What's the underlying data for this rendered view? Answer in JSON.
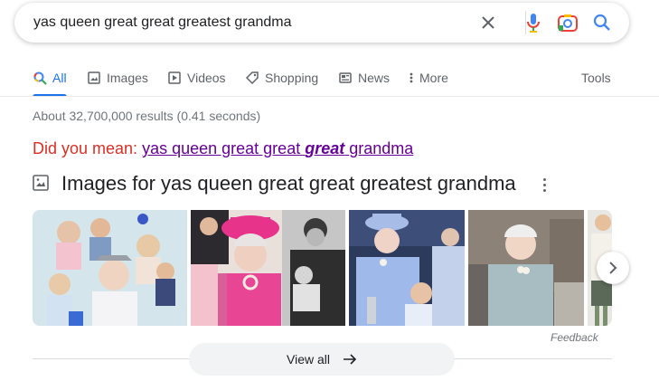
{
  "search": {
    "query": "yas queen great great greatest grandma"
  },
  "tabs": [
    {
      "label": "All",
      "icon": "search-icon"
    },
    {
      "label": "Images",
      "icon": "image-icon"
    },
    {
      "label": "Videos",
      "icon": "play-icon"
    },
    {
      "label": "Shopping",
      "icon": "tag-icon"
    },
    {
      "label": "News",
      "icon": "newspaper-icon"
    },
    {
      "label": "More",
      "icon": "dots-vertical-icon"
    }
  ],
  "tools_label": "Tools",
  "result_stats": "About 32,700,000 results (0.41 seconds)",
  "did_you_mean": {
    "label": "Did you mean:",
    "link_part1": "yas queen great great",
    "link_bold": "great",
    "link_part2": "grandma"
  },
  "images_section": {
    "title": "Images for yas queen great great greatest grandma",
    "feedback": "Feedback",
    "view_all": "View all"
  },
  "colors": {
    "accent": "#1a73e8",
    "did_you_mean_label": "#d93025",
    "visited_link": "#660099"
  }
}
